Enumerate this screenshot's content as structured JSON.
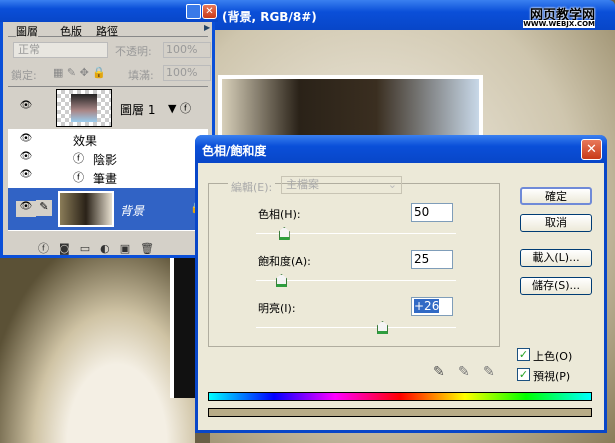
{
  "document": {
    "title": "(背景, RGB/8#)",
    "watermark": "网页教学网",
    "watermark_url": "WWW.WEBJX.COM"
  },
  "layers_panel": {
    "tabs": [
      "圖層",
      "色版",
      "路徑"
    ],
    "blend_mode": "正常",
    "opacity_label": "不透明:",
    "opacity": "100%",
    "lock_label": "鎖定:",
    "fill_label": "填滿:",
    "fill": "100%",
    "layers": [
      {
        "name": "圖層 1",
        "effects_label": "效果",
        "effects": [
          "陰影",
          "筆畫"
        ]
      },
      {
        "name": "背景"
      }
    ]
  },
  "dialog": {
    "title": "色相/飽和度",
    "edit_label": "編輯(E):",
    "edit_value": "主檔案",
    "hue_label": "色相(H):",
    "hue": "50",
    "hue_value": 50,
    "saturation_label": "飽和度(A):",
    "saturation": "25",
    "saturation_value": 25,
    "lightness_label": "明亮(I):",
    "lightness": "+26",
    "lightness_value": 26,
    "buttons": {
      "ok": "確定",
      "cancel": "取消",
      "load": "載入(L)...",
      "save": "儲存(S)..."
    },
    "colorize_label": "上色(O)",
    "colorize": true,
    "preview_label": "預視(P)",
    "preview": true,
    "colorized_bar_color": "#b8ac88"
  }
}
